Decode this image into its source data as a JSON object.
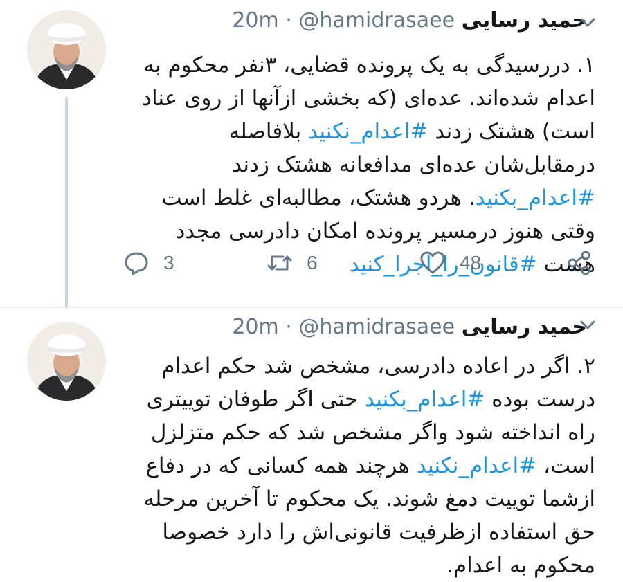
{
  "tweets": [
    {
      "author_name": "حمید رسایی",
      "handle": "@hamidrasaee",
      "separator": "·",
      "time": "20m",
      "body_parts": [
        "۱. دررسیدگی به یک پرونده قضایی، ۳نفر محکوم به اعدام شده‌اند. عده‌ای (که بخشی ازآنها از روی عناد است) هشتک زدند ",
        "#اعدام_نکنید",
        " بلافاصله درمقابل‌شان عده‌ای مدافعانه هشتک زدند ",
        "#اعدام_بکنید",
        ". هردو هشتک، مطالبه‌ای غلط است وقتی هنوز درمسیر پرونده امکان دادرسی مجدد هست ",
        "#قانون_را_اجرا_کنید"
      ],
      "stats": {
        "replies": "3",
        "retweets": "6",
        "likes": "48"
      },
      "icons": [
        "reply-icon",
        "retweet-icon",
        "heart-icon",
        "share-icon",
        "chevron-down-icon"
      ]
    },
    {
      "author_name": "حمید رسایی",
      "handle": "@hamidrasaee",
      "separator": "·",
      "time": "20m",
      "body_parts": [
        "۲. اگر در اعاده دادرسی، مشخص شد حکم اعدام درست بوده ",
        "#اعدام_بکنید",
        " حتی اگر طوفان توییتری راه انداخته شود واگر مشخص شد که حکم متزلزل است، ",
        "#اعدام_نکنید",
        " هرچند همه کسانی که در دفاع ازشما توییت دمغ شوند. یک محکوم تا آخرین مرحله حق استفاده ازظرفیت قانونی‌اش را دارد خصوصا محکوم به اعدام."
      ]
    }
  ],
  "colors": {
    "link": "#1b95e0",
    "text": "#14171a",
    "secondary": "#657786",
    "thread_line": "#ccd6dd"
  }
}
